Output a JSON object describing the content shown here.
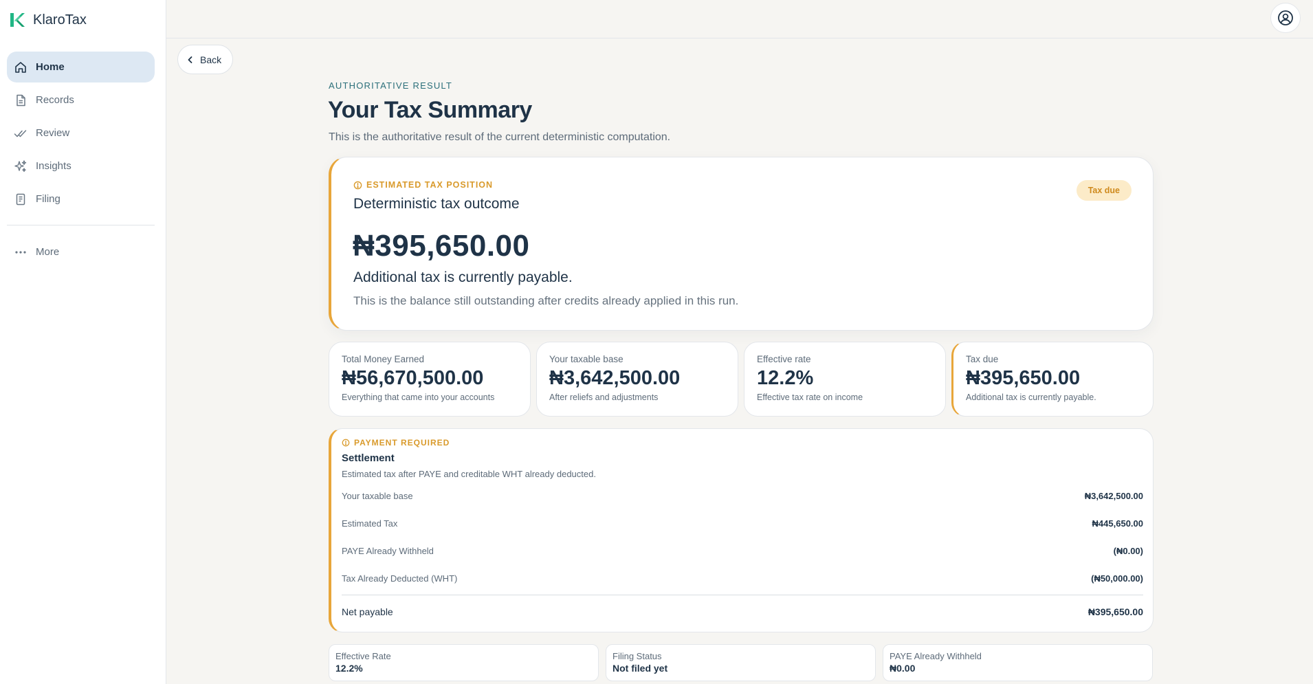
{
  "app": {
    "name": "KlaroTax",
    "logo_icon": "klarotax-logo-icon"
  },
  "sidebar": {
    "items": [
      {
        "label": "Home",
        "icon": "home-icon",
        "active": true
      },
      {
        "label": "Records",
        "icon": "document-icon",
        "active": false
      },
      {
        "label": "Review",
        "icon": "double-check-icon",
        "active": false
      },
      {
        "label": "Insights",
        "icon": "sparkles-icon",
        "active": false
      },
      {
        "label": "Filing",
        "icon": "file-icon",
        "active": false
      }
    ],
    "more": {
      "label": "More",
      "icon": "dots-icon"
    }
  },
  "topbar": {
    "account_icon": "user-circle-icon"
  },
  "back": {
    "label": "Back",
    "icon": "chevron-left-icon"
  },
  "header": {
    "eyebrow": "AUTHORITATIVE RESULT",
    "title": "Your Tax Summary",
    "subtitle": "This is the authoritative result of the current deterministic computation."
  },
  "hero": {
    "label": "ESTIMATED TAX POSITION",
    "title": "Deterministic tax outcome",
    "badge": "Tax due",
    "amount": "₦395,650.00",
    "headline": "Additional tax is currently payable.",
    "description": "This is the balance still outstanding after credits already applied in this run."
  },
  "stats": [
    {
      "label": "Total Money Earned",
      "value": "₦56,670,500.00",
      "desc": "Everything that came into your accounts"
    },
    {
      "label": "Your taxable base",
      "value": "₦3,642,500.00",
      "desc": "After reliefs and adjustments"
    },
    {
      "label": "Effective rate",
      "value": "12.2%",
      "desc": "Effective tax rate on income"
    },
    {
      "label": "Tax due",
      "value": "₦395,650.00",
      "desc": "Additional tax is currently payable."
    }
  ],
  "settlement": {
    "label": "PAYMENT REQUIRED",
    "title": "Settlement",
    "subtitle": "Estimated tax after PAYE and creditable WHT already deducted.",
    "lines": [
      {
        "label": "Your taxable base",
        "value": "₦3,642,500.00"
      },
      {
        "label": "Estimated Tax",
        "value": "₦445,650.00"
      },
      {
        "label": "PAYE Already Withheld",
        "value": "(₦0.00)"
      },
      {
        "label": "Tax Already Deducted (WHT)",
        "value": "(₦50,000.00)"
      }
    ],
    "total": {
      "label": "Net payable",
      "value": "₦395,650.00"
    }
  },
  "summary": [
    {
      "label": "Effective Rate",
      "value": "12.2%"
    },
    {
      "label": "Filing Status",
      "value": "Not filed yet"
    },
    {
      "label": "PAYE Already Withheld",
      "value": "₦0.00"
    }
  ],
  "colors": {
    "accent": "#e8a63a",
    "primary_text": "#1f3347",
    "active_nav": "#dde8f3",
    "eyebrow": "#2b6f7a",
    "brand_green": "#21b685"
  }
}
